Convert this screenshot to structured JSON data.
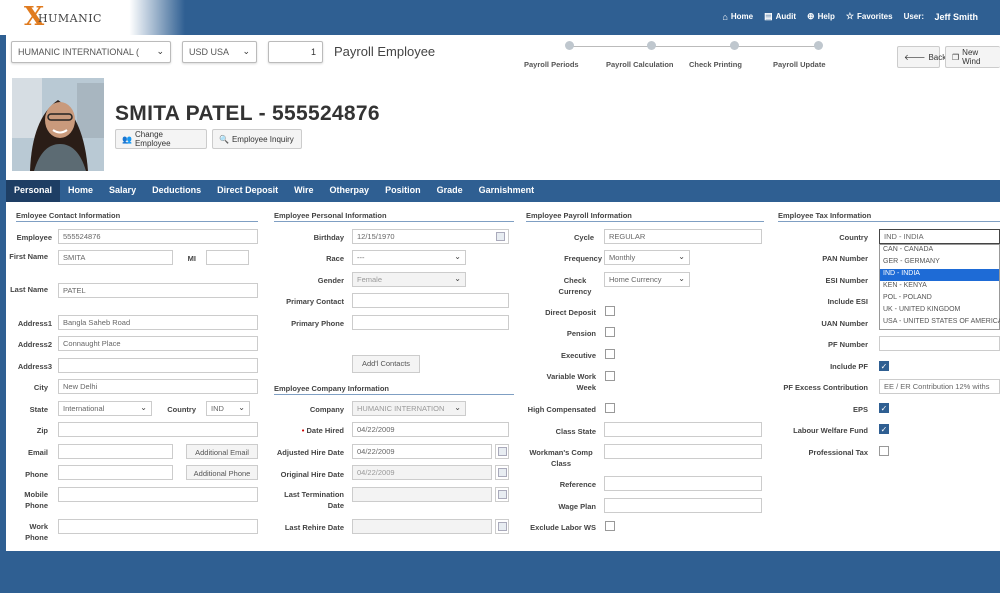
{
  "app": {
    "logo_mark": "X",
    "logo_text": "HUMANIC"
  },
  "topnav": {
    "home": "Home",
    "audit": "Audit",
    "help": "Help",
    "favorites": "Favorites",
    "user_label": "User:",
    "user_name": "Jeff Smith"
  },
  "toolbar": {
    "company": "HUMANIC INTERNATIONAL (",
    "currency": "USD USA",
    "number": "1",
    "module_title": "Payroll Employee",
    "back": "Back",
    "new_window": "New Wind"
  },
  "steps": [
    "Payroll Periods",
    "Payroll Calculation",
    "Check Printing",
    "Payroll Update"
  ],
  "employee": {
    "name": "SMITA PATEL - 555524876",
    "change": "Change Employee",
    "inquiry": "Employee Inquiry"
  },
  "tabs": [
    "Personal",
    "Home",
    "Salary",
    "Deductions",
    "Direct Deposit",
    "Wire",
    "Otherpay",
    "Position",
    "Grade",
    "Garnishment"
  ],
  "contact": {
    "title": "Emloyee Contact Information",
    "employee_label": "Employee",
    "employee": "555524876",
    "first_name_label": "First Name",
    "first_name": "SMITA",
    "mi_label": "MI",
    "mi": "",
    "last_name_label": "Last Name",
    "last_name": "PATEL",
    "address1_label": "Address1",
    "address1": "Bangla Saheb Road",
    "address2_label": "Address2",
    "address2": "Connaught Place",
    "address3_label": "Address3",
    "address3": "",
    "city_label": "City",
    "city": "New Delhi",
    "state_label": "State",
    "state": "International",
    "country_label": "Country",
    "country": "IND",
    "zip_label": "Zip",
    "email_label": "Email",
    "additional_email": "Additional Email",
    "phone_label": "Phone",
    "additional_phone": "Additional Phone",
    "mobile_label": "Mobile Phone",
    "work_label": "Work Phone"
  },
  "personal": {
    "title": "Employee Personal Information",
    "birthday_label": "Birthday",
    "birthday": "12/15/1970",
    "race_label": "Race",
    "race": "---",
    "gender_label": "Gender",
    "gender": "Female",
    "primary_contact_label": "Primary Contact",
    "primary_phone_label": "Primary Phone",
    "add_contacts": "Add'l Contacts"
  },
  "company": {
    "title": "Employee Company Information",
    "company_label": "Company",
    "company": "HUMANIC INTERNATION",
    "date_hired_label": "Date Hired",
    "date_hired": "04/22/2009",
    "adj_hire_label": "Adjusted Hire Date",
    "adj_hire": "04/22/2009",
    "orig_hire_label": "Original Hire Date",
    "orig_hire": "04/22/2009",
    "last_term_label": "Last Termination Date",
    "last_rehire_label": "Last Rehire Date"
  },
  "payroll": {
    "title": "Employee Payroll Information",
    "cycle_label": "Cycle",
    "cycle": "REGULAR",
    "frequency_label": "Frequency",
    "frequency": "Monthly",
    "check_currency_label": "Check Currency",
    "check_currency": "Home Currency",
    "direct_deposit_label": "Direct Deposit",
    "pension_label": "Pension",
    "executive_label": "Executive",
    "variable_work_label": "Variable Work Week",
    "high_comp_label": "High Compensated",
    "class_state_label": "Class State",
    "workmans_label": "Workman's Comp Class",
    "reference_label": "Reference",
    "wage_plan_label": "Wage Plan",
    "exclude_label": "Exclude Labor WS"
  },
  "tax": {
    "title": "Employee Tax Information",
    "country_label": "Country",
    "country": "IND - INDIA",
    "country_options": [
      "CAN - CANADA",
      "GER - GERMANY",
      "IND - INDIA",
      "KEN - KENYA",
      "POL - POLAND",
      "UK - UNITED KINGDOM",
      "USA - UNITED STATES OF AMERICA"
    ],
    "pan_label": "PAN Number",
    "esi_label": "ESI Number",
    "include_esi_label": "Include ESI",
    "uan_label": "UAN Number",
    "pf_label": "PF Number",
    "include_pf_label": "Include PF",
    "pf_excess_label": "PF Excess Contribution",
    "pf_excess": "EE / ER Contribution 12% withs",
    "eps_label": "EPS",
    "labour_label": "Labour Welfare Fund",
    "prof_tax_label": "Professional Tax"
  },
  "colors": {
    "brand": "#2f5f92",
    "tab_active": "#1e3e64",
    "accent": "#e07b1f"
  }
}
